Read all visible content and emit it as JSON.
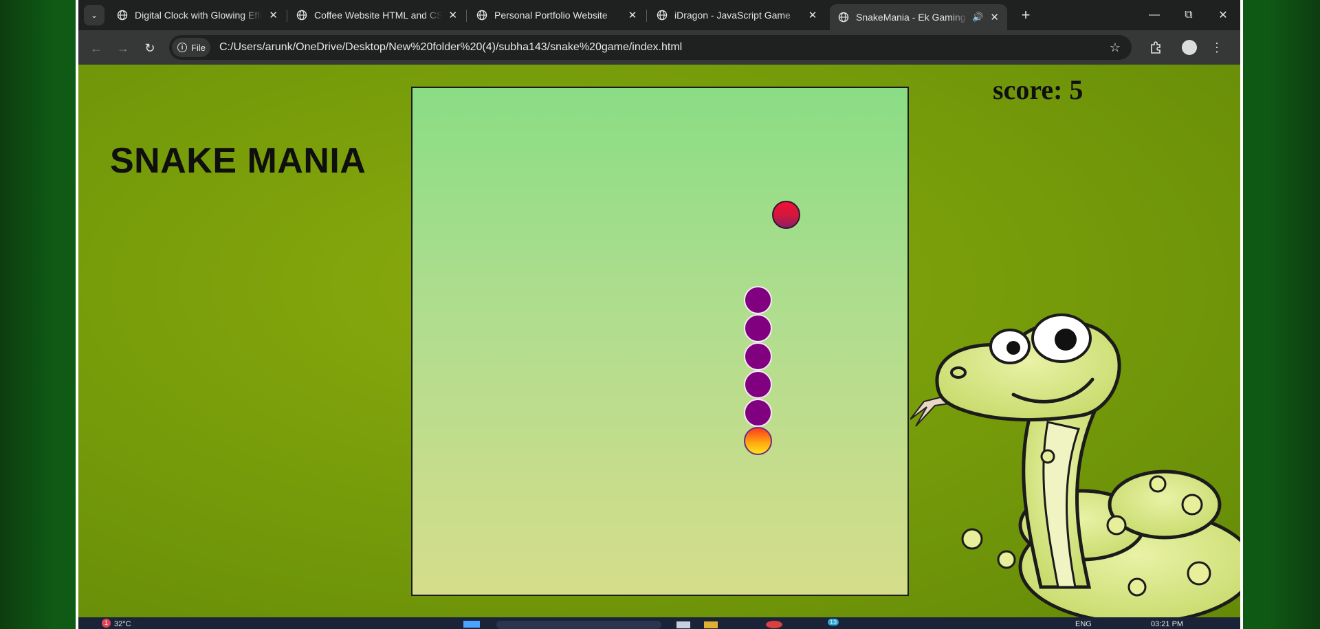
{
  "browser": {
    "tabs": [
      {
        "title": "Digital Clock with Glowing Effect",
        "active": false
      },
      {
        "title": "Coffee Website HTML and CSS | ",
        "active": false
      },
      {
        "title": "Personal Portfolio Website",
        "active": false
      },
      {
        "title": "iDragon - JavaScript Game",
        "active": false
      },
      {
        "title": "SnakeMania - Ek Gaming Kr",
        "active": true
      }
    ],
    "chip_label": "File",
    "url": "C:/Users/arunk/OneDrive/Desktop/New%20folder%20(4)/subha143/snake%20game/index.html"
  },
  "game": {
    "title": "SNAKE MANIA",
    "score_text": "score: 5",
    "grid_size": 18,
    "food": {
      "x": 14,
      "y": 5
    },
    "snake": [
      {
        "x": 13,
        "y": 13
      },
      {
        "x": 13,
        "y": 12
      },
      {
        "x": 13,
        "y": 11
      },
      {
        "x": 13,
        "y": 10
      },
      {
        "x": 13,
        "y": 9
      },
      {
        "x": 13,
        "y": 8
      }
    ],
    "colors": {
      "segment": "#800080",
      "head": "#ffa510",
      "food": "#e0123a"
    }
  },
  "taskbar": {
    "weather": "32°C",
    "weather_badge": "1",
    "language": "ENG",
    "time": "03:21 PM",
    "notification_count": "13"
  }
}
